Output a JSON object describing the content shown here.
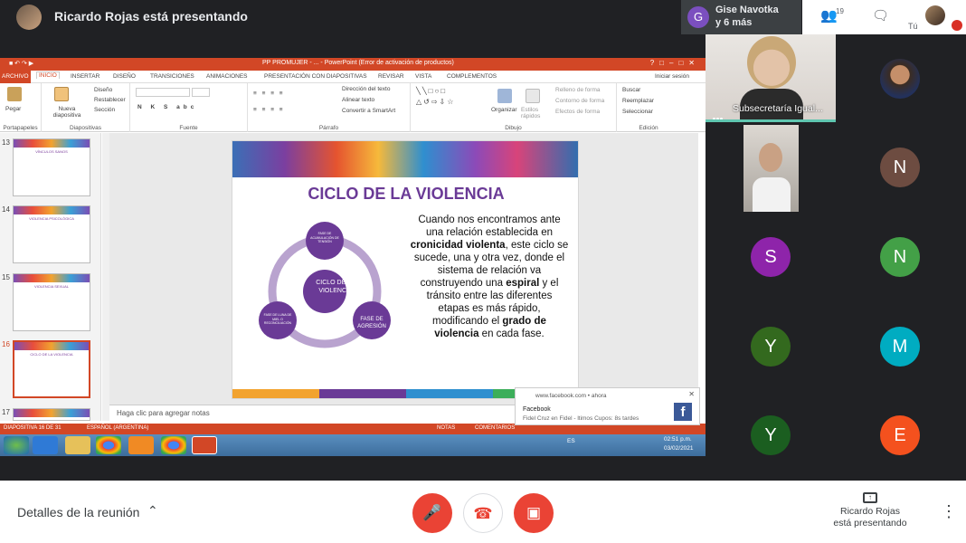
{
  "meet": {
    "presenter_banner": "Ricardo Rojas está presentando",
    "group_avatar_letter": "G",
    "group_names": "Gise Navotka",
    "group_more": "y 6 más",
    "participants_count": "19",
    "self_label": "Tú",
    "tile_main_name": "Subsecretaría Igual...",
    "avatars": [
      {
        "letter": "N",
        "color": "#6d4c41"
      },
      {
        "letter": "S",
        "color": "#8e24aa"
      },
      {
        "letter": "N",
        "color": "#43a047"
      },
      {
        "letter": "Y",
        "color": "#33691e"
      },
      {
        "letter": "M",
        "color": "#00acc1"
      },
      {
        "letter": "Y",
        "color": "#1b5e20"
      },
      {
        "letter": "E",
        "color": "#f4511e"
      }
    ],
    "meeting_details": "Detalles de la reunión",
    "presenting_name": "Ricardo Rojas",
    "presenting_status": "está presentando"
  },
  "powerpoint": {
    "title": "PP PROMUJER - ... - PowerPoint (Error de activación de productos)",
    "tabs": [
      "ARCHIVO",
      "INICIO",
      "INSERTAR",
      "DISEÑO",
      "TRANSICIONES",
      "ANIMACIONES",
      "PRESENTACIÓN CON DIAPOSITIVAS",
      "REVISAR",
      "VISTA",
      "COMPLEMENTOS"
    ],
    "login": "Iniciar sesión",
    "groups": {
      "portapapeles": "Portapapeles",
      "pegar": "Pegar",
      "diapositivas": "Diapositivas",
      "nueva": "Nueva diapositiva",
      "diseno": "Diseño",
      "restablecer": "Restablecer",
      "seccion": "Sección",
      "fuente": "Fuente",
      "parrafo": "Párrafo",
      "direccion": "Dirección del texto",
      "alinear": "Alinear texto",
      "smartart": "Convertir a SmartArt",
      "dibujo": "Dibujo",
      "organizar": "Organizar",
      "estilos": "Estilos rápidos",
      "relleno": "Relleno de forma",
      "contorno": "Contorno de forma",
      "efectos": "Efectos de forma",
      "edicion": "Edición",
      "buscar": "Buscar",
      "reemplazar": "Reemplazar",
      "seleccionar": "Seleccionar"
    },
    "thumbnails": [
      {
        "num": "13",
        "title": "VÍNCULOS SANOS"
      },
      {
        "num": "14",
        "title": "VIOLENCIA PSICOLÓGICA"
      },
      {
        "num": "15",
        "title": "VIOLENCIA SEXUAL"
      },
      {
        "num": "16",
        "title": "CICLO DE LA VIOLENCIA"
      },
      {
        "num": "17",
        "title": ""
      }
    ],
    "slide": {
      "title": "CICLO DE LA VIOLENCIA",
      "center": "CICLO DE LA VIOLENCIA",
      "node_top": "FASE DE ACUMULACIÓN DE TENSIÓN",
      "node_right": "FASE DE AGRESIÓN",
      "node_left": "FASE DE LUNA DE MIEL O RECONCILIACIÓN",
      "text_1": "Cuando nos encontramos ante una relación establecida en ",
      "text_b1": "cronicidad violenta",
      "text_2": ", este ciclo se sucede, una y otra vez, donde el sistema de relación va construyendo una ",
      "text_b2": "espiral",
      "text_3": " y el tránsito entre las diferentes etapas es más rápido, modificando el ",
      "text_b3": "grado de violencia",
      "text_4": " en cada fase."
    },
    "notes_placeholder": "Haga clic para agregar notas",
    "status": {
      "slide": "DIAPOSITIVA 16 DE 31",
      "lang": "ESPAÑOL (ARGENTINA)",
      "notas": "NOTAS",
      "comentarios": "COMENTARIOS"
    },
    "tray": {
      "lang": "ES",
      "time": "02:51 p.m.",
      "date": "03/02/2021"
    }
  },
  "notification": {
    "source": "www.facebook.com • ahora",
    "title": "Facebook",
    "body": "Fidel Cruz en Fidel - ltimos Cupos: 8s tardes",
    "logo": "f"
  },
  "colors": {
    "meet_bg": "#202124",
    "end_call": "#ea4335",
    "powerpoint": "#d24726",
    "slide_purple": "#6a3a96",
    "active_speaker": "#5fc6b0"
  },
  "icons": [
    "people-icon",
    "chat-icon",
    "mic-off-icon",
    "end-call-icon",
    "camera-off-icon",
    "present-icon",
    "more-vert-icon",
    "chevron-up-icon"
  ]
}
